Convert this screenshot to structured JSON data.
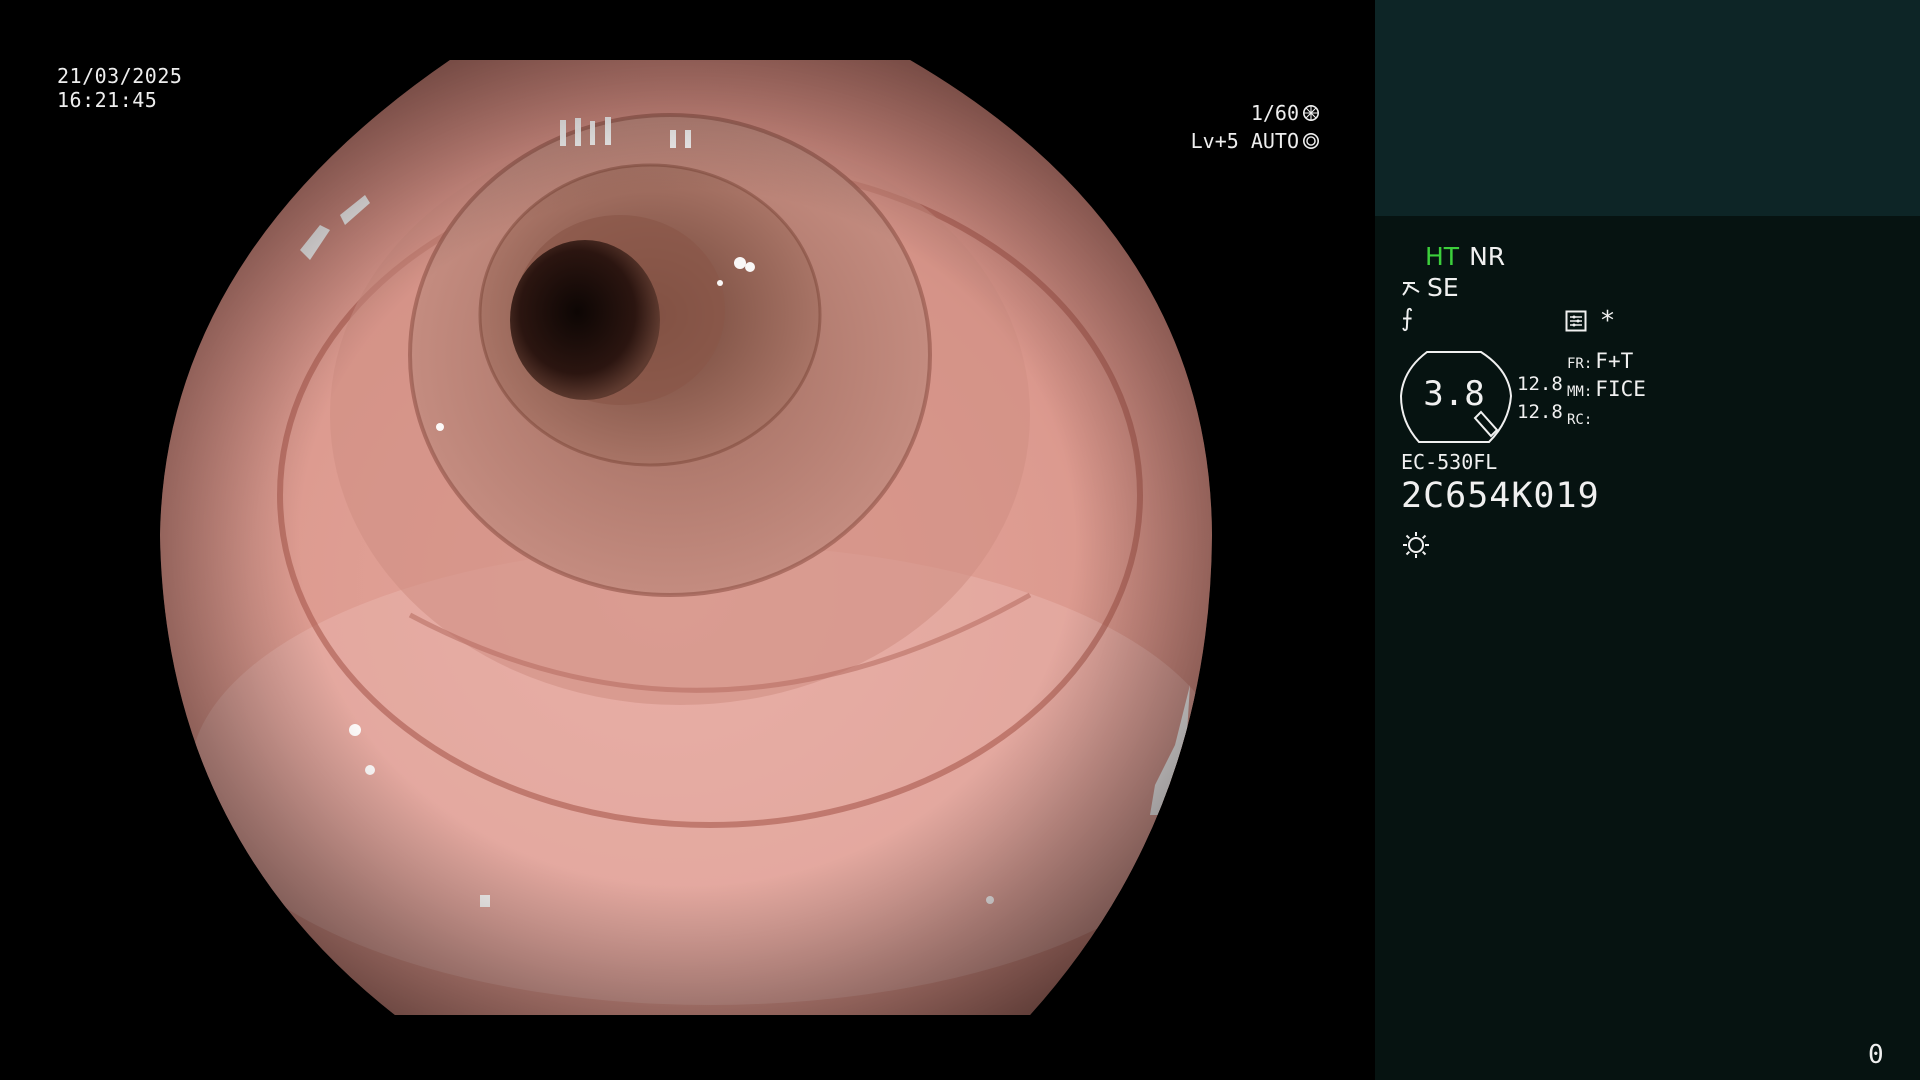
{
  "screen": {
    "date": "21/03/2025",
    "time": "16:21:45"
  },
  "exposure": {
    "shutter": "1/60",
    "shutter_icon": "aperture-icon",
    "level": "Lv+5 AUTO",
    "level_icon": "auto-iris-icon"
  },
  "panel": {
    "modes": {
      "ht": "HT",
      "nr": "NR"
    },
    "se_label": "SE",
    "se_icon": "enhance-icon",
    "f_symbol": "⨍",
    "icons": [
      "settings-list-icon",
      "asterisk-icon"
    ],
    "asterisk": "*",
    "gauge_value": "3.8",
    "nums": [
      "12.8",
      "12.8"
    ],
    "settings": [
      {
        "label": "FR:",
        "value": "F+T"
      },
      {
        "label": "MM:",
        "value": "FICE"
      },
      {
        "label": "RC:",
        "value": ""
      }
    ],
    "scope_model": "EC-530FL",
    "scope_serial": "2C654K019",
    "light_icon": "light-source-icon",
    "counter": "0"
  },
  "colors": {
    "background": "#000000",
    "panel": "#061311",
    "panel_top": "#0d2526",
    "ht_green": "#3ccf3c",
    "mucosa": "#d99288"
  }
}
